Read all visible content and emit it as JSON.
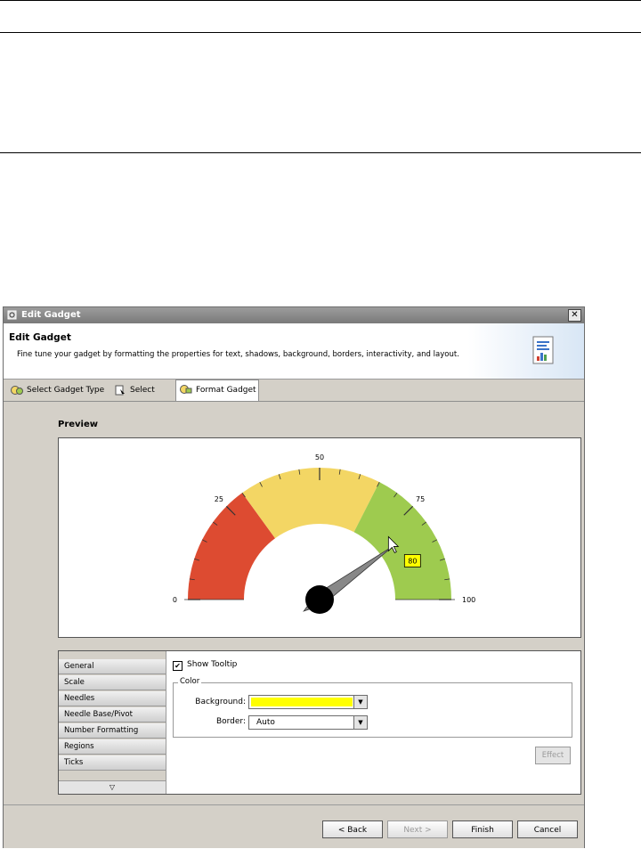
{
  "dialog": {
    "title": "Edit Gadget",
    "close_label": "✕",
    "header_title": "Edit Gadget",
    "header_description": "Fine tune your gadget by formatting the properties for text, shadows, background, borders, interactivity, and layout."
  },
  "tabs": [
    {
      "label": "Select Gadget Type"
    },
    {
      "label": "Select Data"
    },
    {
      "label": "Format Gadget",
      "active": true
    }
  ],
  "preview": {
    "label": "Preview",
    "gauge": {
      "min": 0,
      "max": 100,
      "tick_labels": [
        "0",
        "25",
        "50",
        "75",
        "100"
      ],
      "needle_value": 80,
      "tooltip": "80",
      "regions": [
        {
          "from": 0,
          "to": 30,
          "color": "#dd4b31"
        },
        {
          "from": 30,
          "to": 65,
          "color": "#f3d664"
        },
        {
          "from": 65,
          "to": 100,
          "color": "#9ecb4f"
        }
      ]
    }
  },
  "props": {
    "items": [
      "General",
      "Scale",
      "Needles",
      "Needle Base/Pivot",
      "Number Formatting",
      "Regions",
      "Ticks"
    ],
    "scroll_glyph": "▽",
    "show_tooltip_label": "Show Tooltip",
    "show_tooltip_checked": "✔",
    "color_group_label": "Color",
    "background_label": "Background:",
    "background_color": "#ffff00",
    "border_label": "Border:",
    "border_value": "Auto",
    "effect_label": "Effect"
  },
  "footer": {
    "back": "< Back",
    "next": "Next >",
    "finish": "Finish",
    "cancel": "Cancel"
  }
}
